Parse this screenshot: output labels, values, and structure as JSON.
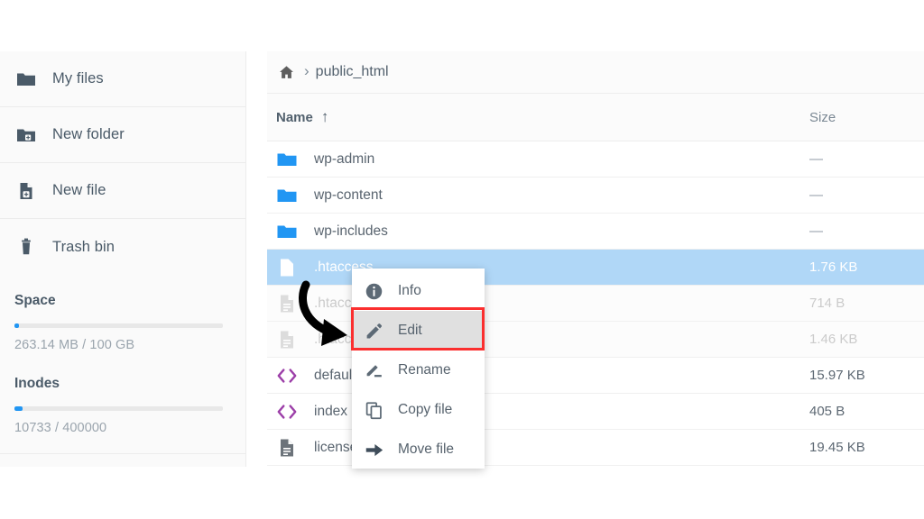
{
  "sidebar": {
    "nav": [
      {
        "label": "My files",
        "icon": "folder-icon",
        "name": "sidebar-item-my-files"
      },
      {
        "label": "New folder",
        "icon": "folder-plus-icon",
        "name": "sidebar-item-new-folder"
      },
      {
        "label": "New file",
        "icon": "file-plus-icon",
        "name": "sidebar-item-new-file"
      },
      {
        "label": "Trash bin",
        "icon": "trash-icon",
        "name": "sidebar-item-trash-bin"
      }
    ],
    "space": {
      "title": "Space",
      "text": "263.14 MB / 100 GB",
      "percent": 2
    },
    "inodes": {
      "title": "Inodes",
      "text": "10733 / 400000",
      "percent": 4
    },
    "accent_color": "#2196f3"
  },
  "breadcrumb": {
    "home_icon": "home-icon",
    "separator": "›",
    "current": "public_html"
  },
  "table": {
    "columns": {
      "name": "Name",
      "size": "Size"
    },
    "sort_indicator": "↑",
    "rows": [
      {
        "name": "wp-admin",
        "size": "—",
        "icon": "folder-icon",
        "state": "normal"
      },
      {
        "name": "wp-content",
        "size": "—",
        "icon": "folder-icon",
        "state": "normal"
      },
      {
        "name": "wp-includes",
        "size": "—",
        "icon": "folder-icon",
        "state": "normal"
      },
      {
        "name": ".htaccess",
        "size": "1.76 KB",
        "icon": "file-icon",
        "state": "selected"
      },
      {
        "name": ".htaccess",
        "size": "714 B",
        "icon": "file-icon",
        "state": "dim"
      },
      {
        "name": ".htaccess",
        "size": "1.46 KB",
        "icon": "file-icon",
        "state": "dim"
      },
      {
        "name": "default",
        "size": "15.97 KB",
        "icon": "code-icon",
        "state": "normal"
      },
      {
        "name": "index",
        "size": "405 B",
        "icon": "code-icon",
        "state": "normal"
      },
      {
        "name": "license",
        "size": "19.45 KB",
        "icon": "file-icon",
        "state": "normal"
      }
    ],
    "selection_color": "#b0d7f7",
    "folder_color": "#2196f3",
    "code_icon_color": "#9c3fa8"
  },
  "context_menu": {
    "items": [
      {
        "label": "Info",
        "icon": "info-icon",
        "highlighted": false
      },
      {
        "label": "Edit",
        "icon": "pencil-icon",
        "highlighted": true
      },
      {
        "label": "Rename",
        "icon": "rename-icon",
        "highlighted": false
      },
      {
        "label": "Copy file",
        "icon": "copy-icon",
        "highlighted": false
      },
      {
        "label": "Move file",
        "icon": "arrow-right-icon",
        "highlighted": false
      }
    ],
    "highlight_color": "#fb2f2f"
  },
  "annotation": {
    "arrow": "curved-arrow-icon",
    "color": "#000000"
  }
}
